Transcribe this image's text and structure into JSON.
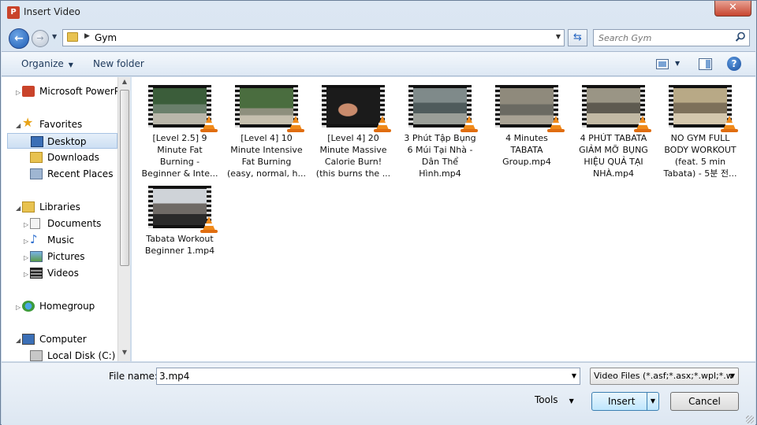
{
  "window": {
    "title": "Insert Video",
    "app_icon": "P",
    "close_glyph": "✕"
  },
  "address": {
    "crumb": "Gym"
  },
  "search": {
    "placeholder": "Search Gym"
  },
  "toolbar": {
    "organize": "Organize",
    "new_folder": "New folder",
    "help": "?"
  },
  "nav": {
    "items": [
      {
        "label": "Microsoft PowerPoint",
        "icon": "powerpoint-icon"
      },
      {
        "label": "Favorites",
        "icon": "star-icon"
      },
      {
        "label": "Desktop",
        "icon": "desktop-icon",
        "selected": true
      },
      {
        "label": "Downloads",
        "icon": "downloads-icon"
      },
      {
        "label": "Recent Places",
        "icon": "recent-places-icon"
      },
      {
        "label": "Libraries",
        "icon": "libraries-icon"
      },
      {
        "label": "Documents",
        "icon": "documents-icon"
      },
      {
        "label": "Music",
        "icon": "music-icon"
      },
      {
        "label": "Pictures",
        "icon": "pictures-icon"
      },
      {
        "label": "Videos",
        "icon": "videos-icon"
      },
      {
        "label": "Homegroup",
        "icon": "homegroup-icon"
      },
      {
        "label": "Computer",
        "icon": "computer-icon"
      },
      {
        "label": "Local Disk (C:)",
        "icon": "disk-icon"
      }
    ]
  },
  "files": [
    {
      "line1": "[Level 2.5] 9",
      "line2": "Minute Fat",
      "line3": "Burning -",
      "line4": "Beginner & Inte..."
    },
    {
      "line1": "[Level 4] 10",
      "line2": "Minute Intensive",
      "line3": "Fat Burning",
      "line4": "(easy, normal, h..."
    },
    {
      "line1": "[Level 4] 20",
      "line2": "Minute Massive",
      "line3": "Calorie Burn!",
      "line4": "(this burns the ..."
    },
    {
      "line1": "3 Phút Tập Bụng",
      "line2": "6 Múi Tại Nhà -",
      "line3": "Dân Thể",
      "line4": "Hình.mp4"
    },
    {
      "line1": "4 Minutes",
      "line2": "TABATA",
      "line3": "Group.mp4",
      "line4": ""
    },
    {
      "line1": "4 PHÚT TABATA",
      "line2": "GIẢM MỠ BỤNG",
      "line3": "HIỆU QUẢ TẠI",
      "line4": "NHÀ.mp4"
    },
    {
      "line1": "NO GYM FULL",
      "line2": "BODY WORKOUT",
      "line3": "(feat. 5 min",
      "line4": "Tabata) - 5분 전..."
    },
    {
      "line1": "Tabata Workout",
      "line2": "Beginner 1.mp4",
      "line3": "",
      "line4": ""
    }
  ],
  "bottom": {
    "file_name_label": "File name:",
    "file_name_value": "3.mp4",
    "file_type": "Video Files (*.asf;*.asx;*.wpl;*.w",
    "tools": "Tools",
    "insert": "Insert",
    "cancel": "Cancel"
  }
}
